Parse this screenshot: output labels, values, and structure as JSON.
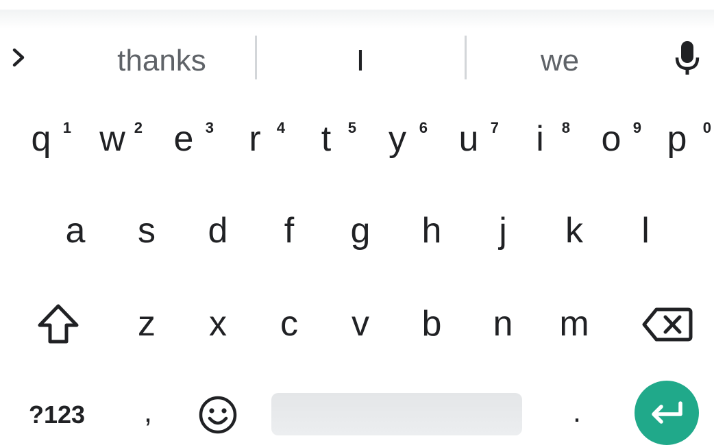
{
  "suggestions": {
    "left": "thanks",
    "center": "I",
    "right": "we"
  },
  "icons": {
    "expand": "chevron-right-icon",
    "mic": "microphone-icon",
    "shift": "shift-icon",
    "backspace": "backspace-icon",
    "emoji": "emoji-icon",
    "enter": "enter-icon"
  },
  "rows": {
    "row1": [
      {
        "label": "q",
        "hint": "1"
      },
      {
        "label": "w",
        "hint": "2"
      },
      {
        "label": "e",
        "hint": "3"
      },
      {
        "label": "r",
        "hint": "4"
      },
      {
        "label": "t",
        "hint": "5"
      },
      {
        "label": "y",
        "hint": "6"
      },
      {
        "label": "u",
        "hint": "7"
      },
      {
        "label": "i",
        "hint": "8"
      },
      {
        "label": "o",
        "hint": "9"
      },
      {
        "label": "p",
        "hint": "0"
      }
    ],
    "row2": [
      {
        "label": "a"
      },
      {
        "label": "s"
      },
      {
        "label": "d"
      },
      {
        "label": "f"
      },
      {
        "label": "g"
      },
      {
        "label": "h"
      },
      {
        "label": "j"
      },
      {
        "label": "k"
      },
      {
        "label": "l"
      }
    ],
    "row3": [
      {
        "label": "z"
      },
      {
        "label": "x"
      },
      {
        "label": "c"
      },
      {
        "label": "v"
      },
      {
        "label": "b"
      },
      {
        "label": "n"
      },
      {
        "label": "m"
      }
    ]
  },
  "bottom": {
    "symbols": "?123",
    "comma": ",",
    "period": "."
  },
  "colors": {
    "enter_bg": "#20a98a",
    "key_text": "#202124",
    "suggestion_text": "#5f6368"
  }
}
